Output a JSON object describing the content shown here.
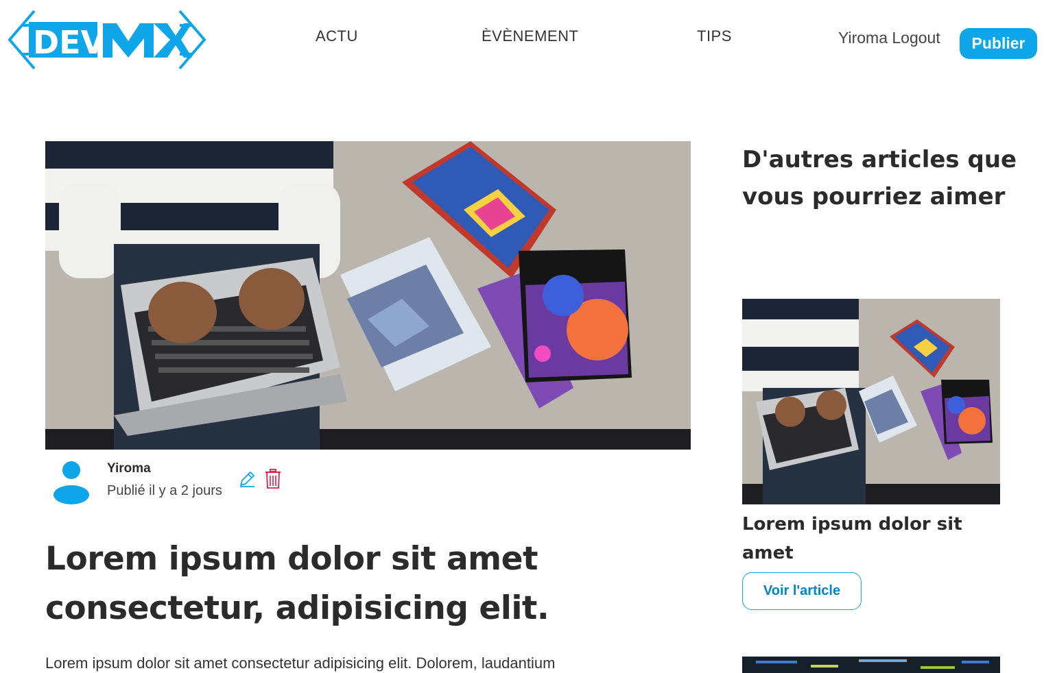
{
  "brand": {
    "logo_text_left": "DEV",
    "logo_text_right": "MX",
    "accent_color": "#0ea5e9",
    "danger_color": "#e11d48"
  },
  "nav": {
    "items": [
      {
        "label": "ACTU"
      },
      {
        "label": "ÈVÈNEMENT"
      },
      {
        "label": "TIPS"
      }
    ],
    "user_name": "Yiroma",
    "logout_label": "Logout",
    "publish_label": "Publier"
  },
  "article": {
    "hero_image_icon": "laptop-books-photo",
    "author_name": "Yiroma",
    "published": "Publié il y a 2 jours",
    "title": "Lorem ipsum dolor sit amet consectetur, adipisicing elit.",
    "body": "Lorem ipsum dolor sit amet consectetur adipisicing elit. Dolorem, laudantium"
  },
  "sidebar": {
    "heading": "D'autres articles que vous pourriez aimer",
    "cards": [
      {
        "title": "Lorem ipsum dolor sit amet",
        "button": "Voir l'article"
      }
    ]
  }
}
